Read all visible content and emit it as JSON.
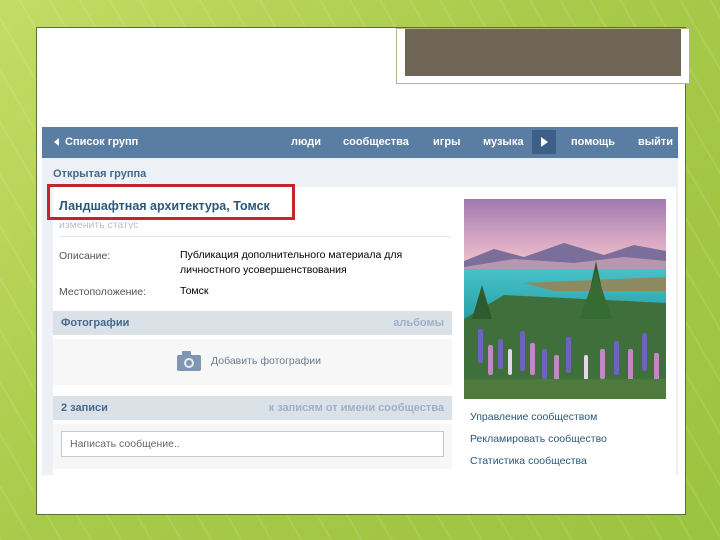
{
  "topbar": {
    "back_label": "Список групп",
    "nav": [
      "люди",
      "сообщества",
      "игры",
      "музыка"
    ],
    "help": "помощь",
    "logout": "выйти"
  },
  "group": {
    "type": "Открытая группа",
    "name": "Ландшафтная архитектура, Томск",
    "status": "изменить статус"
  },
  "info": {
    "description_label": "Описание:",
    "description_value": "Публикация дополнительного материала для личностного усовершенствования",
    "location_label": "Местоположение:",
    "location_value": "Томск"
  },
  "photos": {
    "title": "Фотографии",
    "albums_link": "альбомы",
    "add_label": "Добавить фотографии"
  },
  "posts": {
    "count_label": "2 записи",
    "link": "к записям от имени сообщества",
    "placeholder": "Написать сообщение.."
  },
  "sidebar": {
    "links": [
      "Управление сообществом",
      "Рекламировать сообщество",
      "Статистика сообщества"
    ]
  },
  "colors": {
    "highlight": "#c6242d",
    "header_bar": "#597da3",
    "link": "#2b587a"
  }
}
